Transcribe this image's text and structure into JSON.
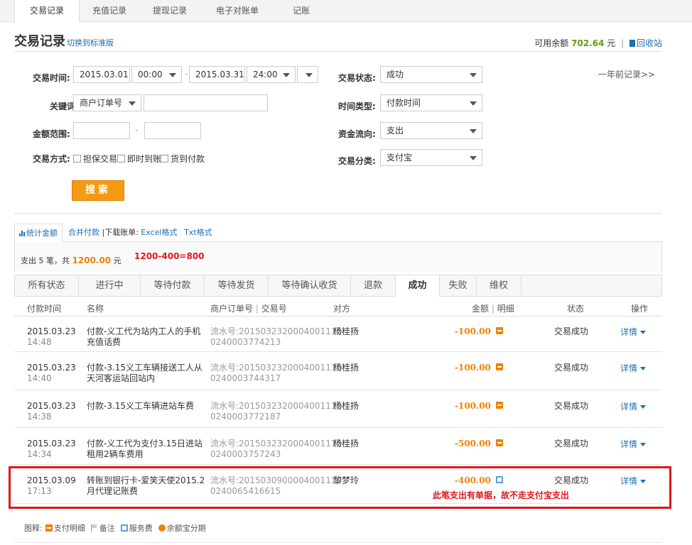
{
  "nav": {
    "tabs": [
      "交易记录",
      "充值记录",
      "提现记录",
      "电子对账单",
      "记账"
    ]
  },
  "header": {
    "title": "交易记录",
    "switch_link": "切换到标准版",
    "balance_label": "可用余额",
    "balance_amount": "702.64",
    "balance_unit": "元",
    "recycle_link": "回收站"
  },
  "filters": {
    "trade_time_label": "交易时间:",
    "start_date": "2015.03.01",
    "start_time": "00:00",
    "end_date": "2015.03.31",
    "end_time": "24:00",
    "history_link": "一年前记录>>",
    "status_label": "交易状态:",
    "status_value": "成功",
    "keyword_label": "关键词:",
    "keyword_type": "商户订单号",
    "keyword_value": "",
    "time_type_label": "时间类型:",
    "time_type_value": "付款时间",
    "amount_label": "金额范围:",
    "amount_min": "",
    "amount_max": "",
    "flow_label": "资金流向:",
    "flow_value": "支出",
    "method_label": "交易方式:",
    "methods": [
      "担保交易",
      "即时到账",
      "货到付款"
    ],
    "category_label": "交易分类:",
    "category_value": "支付宝",
    "search_button": "搜索"
  },
  "stats": {
    "tab_label": "统计金额",
    "merge_link": "合并付款",
    "download_label": "|下载账单:",
    "excel_link": "Excel格式",
    "txt_link": "Txt格式",
    "summary_prefix": "支出 5 笔，共",
    "summary_amount": "1200.00",
    "summary_unit": "元",
    "calc_note": "1200-400=800"
  },
  "status_tabs": [
    "所有状态",
    "进行中",
    "等待付款",
    "等待发货",
    "等待确认收货",
    "退款",
    "成功",
    "失败",
    "维权"
  ],
  "table": {
    "headers": {
      "time": "付款时间",
      "name": "名称",
      "order_a": "商户订单号",
      "order_sep": "|",
      "order_b": "交易号",
      "party": "对方",
      "amount": "金额",
      "amount_sep": "|",
      "detail": "明细",
      "status": "状态",
      "op": "操作"
    },
    "rows": [
      {
        "date": "2015.03.23",
        "time": "14:48",
        "name": "付款-义工代为站内工人的手机充值话费",
        "serial_a": "流水号:2015032320004001110",
        "serial_b": "0240003774213",
        "party": "杨桂扬",
        "amount": "-100.00",
        "status": "交易成功",
        "op": "详情"
      },
      {
        "date": "2015.03.23",
        "time": "14:40",
        "name": "付款-3.15义工车辆接送工人从天河客运站回站内",
        "serial_a": "流水号:2015032320004001110",
        "serial_b": "0240003744317",
        "party": "杨桂扬",
        "amount": "-100.00",
        "status": "交易成功",
        "op": "详情"
      },
      {
        "date": "2015.03.23",
        "time": "14:38",
        "name": "付款-3.15义工车辆进站车费",
        "serial_a": "流水号:2015032320004001110",
        "serial_b": "0240003772187",
        "party": "杨桂扬",
        "amount": "-100.00",
        "status": "交易成功",
        "op": "详情"
      },
      {
        "date": "2015.03.23",
        "time": "14:34",
        "name": "付款-义工代为支付3.15日进站租用2辆车费用",
        "serial_a": "流水号:2015032320004001110",
        "serial_b": "0240003757243",
        "party": "杨桂扬",
        "amount": "-500.00",
        "status": "交易成功",
        "op": "详情"
      },
      {
        "date": "2015.03.09",
        "time": "17:13",
        "name": "转账到银行卡-爱笑天使2015.2月代理记账费",
        "serial_a": "流水号:2015030900004001110",
        "serial_b": "0240065416615",
        "party": "黎梦玲",
        "amount": "-400.00",
        "status": "交易成功",
        "op": "详情"
      }
    ],
    "annotation": "此笔支出有单据，故不走支付宝支出"
  },
  "legend": {
    "title": "图释:",
    "items": [
      "支付明细",
      "备注",
      "服务费",
      "余额宝分期"
    ]
  },
  "colors": {
    "accent_orange": "#f08200",
    "link_blue": "#1a6fb5",
    "balance_green": "#5aa20b",
    "annotation_red": "#e0161b"
  }
}
